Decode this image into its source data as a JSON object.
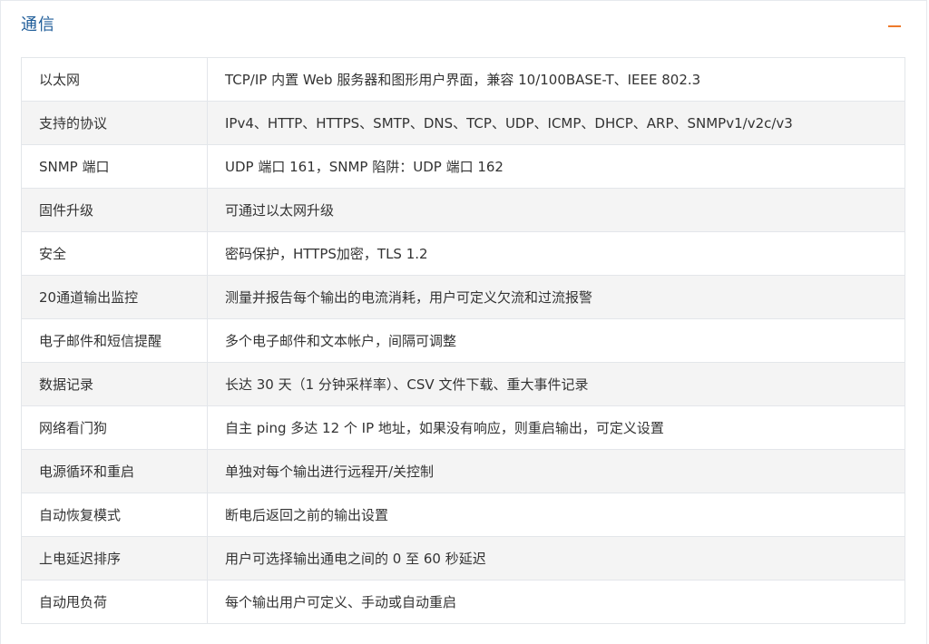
{
  "section": {
    "title": "通信",
    "collapse_symbol": "−"
  },
  "specs": [
    {
      "label": "以太网",
      "value": "TCP/IP 内置 Web 服务器和图形用户界面，兼容 10/100BASE-T、IEEE 802.3"
    },
    {
      "label": "支持的协议",
      "value": "IPv4、HTTP、HTTPS、SMTP、DNS、TCP、UDP、ICMP、DHCP、ARP、SNMPv1/v2c/v3"
    },
    {
      "label": "SNMP 端口",
      "value": "UDP 端口 161，SNMP 陷阱：UDP 端口 162"
    },
    {
      "label": "固件升级",
      "value": "可通过以太网升级"
    },
    {
      "label": "安全",
      "value": "密码保护，HTTPS加密，TLS 1.2"
    },
    {
      "label": "20通道输出监控",
      "value": "测量并报告每个输出的电流消耗，用户可定义欠流和过流报警"
    },
    {
      "label": "电子邮件和短信提醒",
      "value": "多个电子邮件和文本帐户，间隔可调整"
    },
    {
      "label": "数据记录",
      "value": "长达 30 天（1 分钟采样率）、CSV 文件下载、重大事件记录"
    },
    {
      "label": "网络看门狗",
      "value": "自主 ping 多达 12 个 IP 地址，如果没有响应，则重启输出，可定义设置"
    },
    {
      "label": "电源循环和重启",
      "value": "单独对每个输出进行远程开/关控制"
    },
    {
      "label": "自动恢复模式",
      "value": "断电后返回之前的输出设置"
    },
    {
      "label": "上电延迟排序",
      "value": "用户可选择输出通电之间的 0 至 60 秒延迟"
    },
    {
      "label": "自动甩负荷",
      "value": "每个输出用户可定义、手动或自动重启"
    }
  ],
  "colors": {
    "title": "#1f5d99",
    "collapse_icon": "#ee7a2b",
    "stripe": "#f4f4f4",
    "border": "#e3e6ea"
  }
}
